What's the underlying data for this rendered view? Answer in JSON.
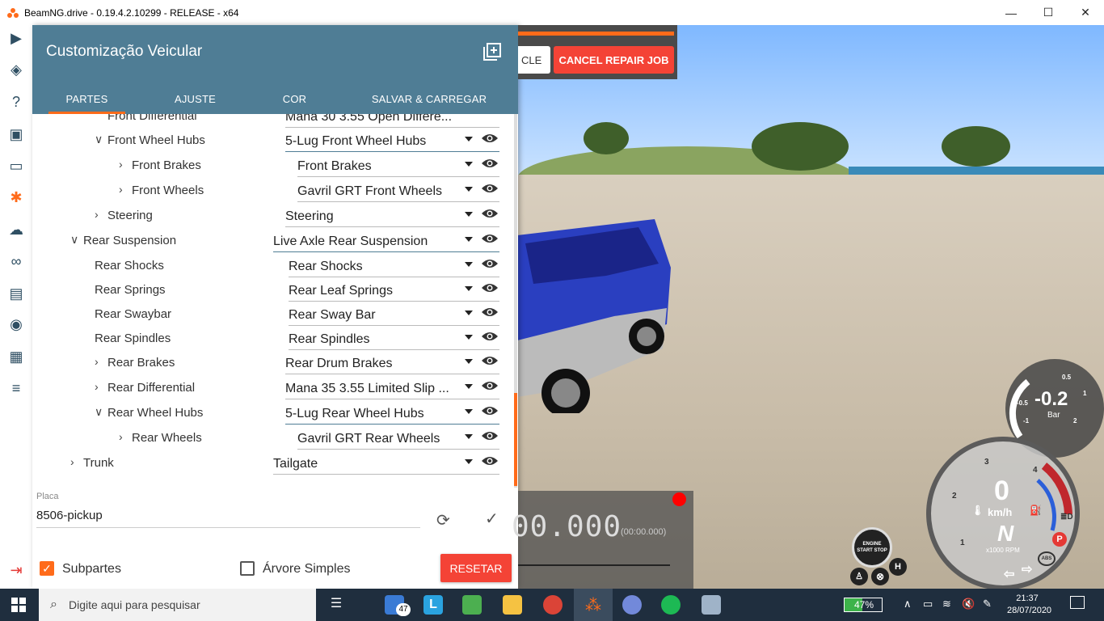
{
  "window": {
    "title": "BeamNG.drive - 0.19.4.2.10299 - RELEASE - x64",
    "minimize": "—",
    "maximize": "☐",
    "close": "✕"
  },
  "sidebar": {
    "icons": [
      "play-icon",
      "layers-icon",
      "help-icon",
      "case-icon",
      "car-icon",
      "gear-icon",
      "cloud-icon",
      "infinity-icon",
      "film-icon",
      "camera-icon",
      "layout-icon",
      "sliders-icon",
      "exit-icon"
    ]
  },
  "panel": {
    "title": "Customização Veicular",
    "tabs": [
      "PARTES",
      "AJUSTE",
      "COR",
      "SALVAR & CARREGAR"
    ],
    "rows": [
      {
        "label": "Front Differential",
        "value": "Mana 30 3.55 Open Differe..."
      },
      {
        "label": "Front Wheel Hubs",
        "value": "5-Lug Front Wheel Hubs"
      },
      {
        "label": "Front Brakes",
        "value": "Front Brakes"
      },
      {
        "label": "Front Wheels",
        "value": "Gavril GRT Front Wheels"
      },
      {
        "label": "Steering",
        "value": "Steering"
      },
      {
        "label": "Rear Suspension",
        "value": "Live Axle Rear Suspension"
      },
      {
        "label": "Rear Shocks",
        "value": "Rear Shocks"
      },
      {
        "label": "Rear Springs",
        "value": "Rear Leaf Springs"
      },
      {
        "label": "Rear Swaybar",
        "value": "Rear Sway Bar"
      },
      {
        "label": "Rear Spindles",
        "value": "Rear Spindles"
      },
      {
        "label": "Rear Brakes",
        "value": "Rear Drum Brakes"
      },
      {
        "label": "Rear Differential",
        "value": "Mana 35 3.55 Limited Slip ..."
      },
      {
        "label": "Rear Wheel Hubs",
        "value": "5-Lug Rear Wheel Hubs"
      },
      {
        "label": "Rear Wheels",
        "value": "Gavril GRT Rear Wheels"
      },
      {
        "label": "Trunk",
        "value": "Tailgate"
      }
    ],
    "plate_label": "Placa",
    "plate_value": "8506-pickup",
    "subparts_label": "Subpartes",
    "simple_tree_label": "Árvore Simples",
    "reset_label": "RESETAR"
  },
  "repair": {
    "left_label": "CLE",
    "cancel_label": "CANCEL REPAIR JOB"
  },
  "timer": {
    "value": "00.000",
    "sub": "(00:00.000)"
  },
  "gauges": {
    "boost_value": "-0.2",
    "boost_unit": "Bar",
    "boost_ticks": [
      "0.5",
      "-0.5",
      "1",
      "-1",
      "2"
    ],
    "speed_value": "0",
    "speed_unit": "km/h",
    "gear": "N",
    "rpm_unit": "x1000 RPM",
    "rpm_ticks": [
      "1",
      "2",
      "3",
      "4"
    ],
    "engine_label": "ENGINE START STOP",
    "abs_label": "ABS",
    "park_label": "P",
    "h_label": "H"
  },
  "taskbar": {
    "search_placeholder": "Digite aqui para pesquisar",
    "mail_badge": "47",
    "battery": "47%",
    "battery_level": 0.47,
    "time": "21:37",
    "date": "28/07/2020"
  },
  "colors": {
    "accent": "#ff6b1a",
    "panel_header": "#4f7d95",
    "danger": "#f44336"
  }
}
